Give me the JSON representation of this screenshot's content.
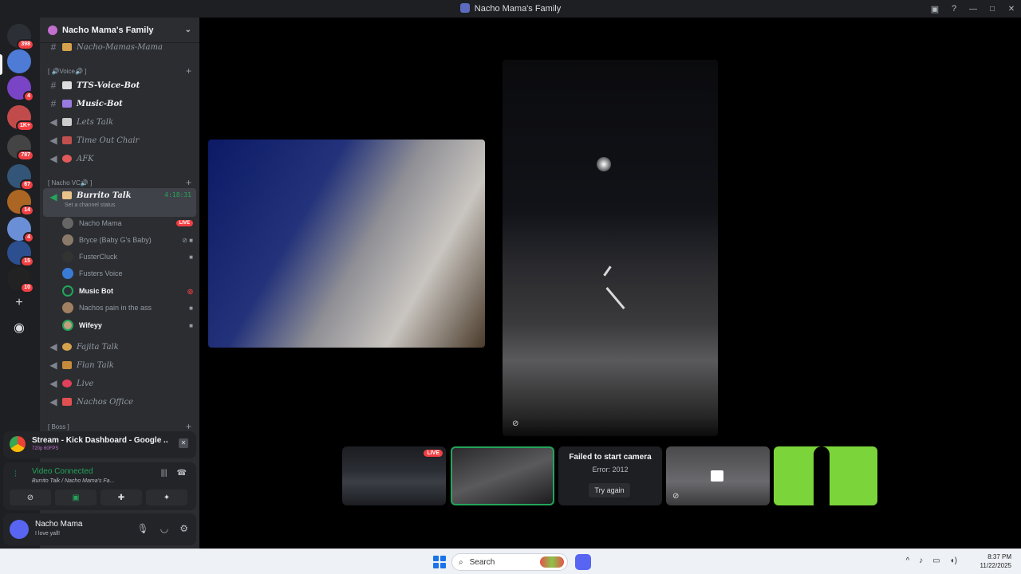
{
  "window": {
    "title": "Nacho Mama's Family"
  },
  "servers": [
    {
      "badge": "398",
      "color": "#2c2f35"
    },
    {
      "badge": "",
      "color": "#4d7bd6"
    },
    {
      "badge": "4",
      "color": "#7a44c6"
    },
    {
      "badge": "1K+",
      "color": "#c14b4b"
    },
    {
      "badge": "787",
      "color": "#444"
    },
    {
      "badge": "67",
      "color": "#335577"
    },
    {
      "badge": "14",
      "color": "#aa6622"
    },
    {
      "badge": "4",
      "color": "#6b8fd6"
    },
    {
      "badge": "15",
      "color": "#2c4f8f"
    },
    {
      "badge": "10",
      "color": "#222"
    }
  ],
  "guild": {
    "name": "Nacho Mama's Family"
  },
  "channels": {
    "top": "Nacho-Mamas-Mama",
    "cat_voice": "[ 🔊Voice🔊 ]",
    "tts": "TTS-Voice-Bot",
    "music": "Music-Bot",
    "lets_talk": "Lets Talk",
    "timeout": "Time Out Chair",
    "afk": "AFK",
    "cat_nacho": "[ Nacho VC🔊 ]",
    "burrito": "Burrito Talk",
    "burrito_time": "4:18:31",
    "status_hint": "Set a channel status",
    "fajita": "Fajita Talk",
    "flan": "Flan Talk",
    "live": "Live",
    "office": "Nachos Office",
    "cat_boss": "[ Boss ]"
  },
  "voice_users": [
    {
      "name": "Nacho Mama",
      "live": "LIVE",
      "color": "#666"
    },
    {
      "name": "Bryce (Baby G's Baby)",
      "color": "#8a7a6a"
    },
    {
      "name": "FusterCluck",
      "color": "#333"
    },
    {
      "name": "Fusters Voice",
      "color": "#3a7bd5"
    },
    {
      "name": "Music Bot",
      "color": "#2c2f35"
    },
    {
      "name": "Nachos pain in the ass",
      "color": "#a08060"
    },
    {
      "name": "Wifeyy",
      "color": "#c0a080"
    }
  ],
  "stream": {
    "title": "Stream - Kick Dashboard - Google ...",
    "sub": "720p 60FPS"
  },
  "vc": {
    "title": "Video Connected",
    "sub": "Burrito Talk / Nacho Mama's Fa..."
  },
  "user": {
    "name": "Nacho Mama",
    "status": "I love yall!"
  },
  "strip": {
    "live": "LIVE",
    "fail_title": "Failed to start camera",
    "fail_error": "Error: 2012",
    "fail_button": "Try again"
  },
  "taskbar": {
    "search": "Search",
    "time": "8:37 PM",
    "date": "11/22/2025"
  }
}
